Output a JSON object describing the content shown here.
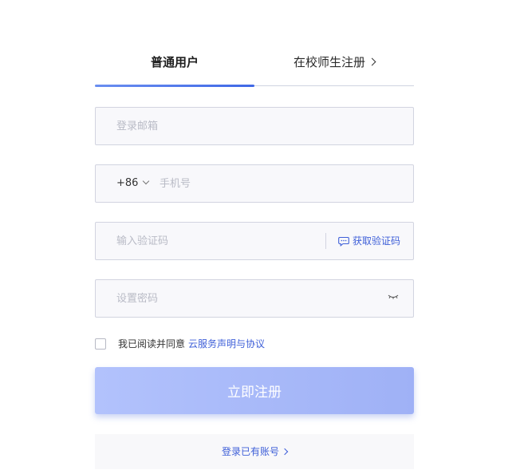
{
  "tabs": {
    "normal_user": "普通用户",
    "school_register": "在校师生注册"
  },
  "form": {
    "email_placeholder": "登录邮箱",
    "country_code": "+86",
    "phone_placeholder": "手机号",
    "code_placeholder": "输入验证码",
    "get_code_label": "获取验证码",
    "password_placeholder": "设置密码"
  },
  "agreement": {
    "text": "我已阅读并同意",
    "link": "云服务声明与协议",
    "checked": false
  },
  "submit_label": "立即注册",
  "login_link": "登录已有账号",
  "colors": {
    "accent": "#3e5fd8",
    "button_gradient_start": "#b2c2fc",
    "button_gradient_end": "#9fb1f6",
    "input_bg": "#f8f8fb",
    "input_border": "#d2d4e0"
  },
  "icons": {
    "school_tab_arrow": "chevron-right-icon",
    "country_dropdown": "chevron-down-icon",
    "get_code": "message-icon",
    "password_toggle": "eye-closed-icon",
    "login_arrow": "chevron-right-icon"
  }
}
